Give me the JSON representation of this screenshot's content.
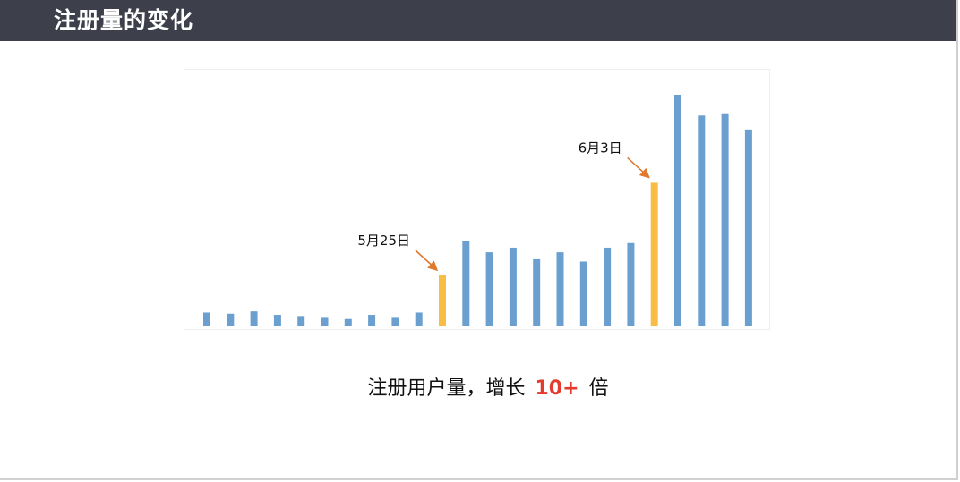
{
  "header": {
    "title": "注册量的变化"
  },
  "caption": {
    "before": "注册用户量，增长",
    "highlight": "10+",
    "after": "倍"
  },
  "colors": {
    "normal": "#6a9fd0",
    "highlight": "#f8bd45",
    "arrow": "#e07a2e",
    "header_bg": "#3d404b",
    "emphasis": "#e33b2e"
  },
  "chart_data": {
    "type": "bar",
    "title": "",
    "xlabel": "",
    "ylabel": "",
    "ylim": [
      0,
      100
    ],
    "values": [
      6,
      5.5,
      6.5,
      5,
      4.5,
      3.7,
      3.2,
      5,
      3.7,
      6,
      22,
      37,
      32,
      34,
      29,
      32,
      28,
      34,
      36,
      62,
      100,
      91,
      92,
      85
    ],
    "highlight_indices": [
      10,
      19
    ],
    "annotations": [
      {
        "label": "5月25日",
        "bar_index": 10
      },
      {
        "label": "6月3日",
        "bar_index": 19
      }
    ]
  }
}
